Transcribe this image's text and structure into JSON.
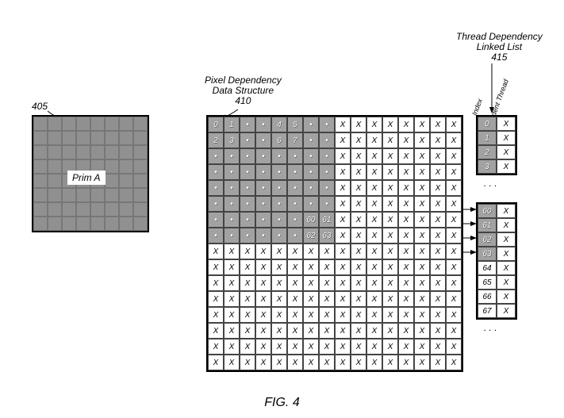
{
  "refs": {
    "prim": "405",
    "pds": "410",
    "tdll": "415"
  },
  "titles": {
    "pds_l1": "Pixel Dependency",
    "pds_l2": "Data Structure",
    "tdll_l1": "Thread Dependency",
    "tdll_l2": "Linked List",
    "col_index": "Index",
    "col_dep": "Dependent Thread"
  },
  "prim": {
    "label": "Prim A",
    "rows": 8,
    "cols": 8
  },
  "pds": {
    "rows": 16,
    "cols": 16,
    "numbered_cells": {
      "0,0": "0",
      "0,1": "1",
      "0,4": "4",
      "0,5": "5",
      "1,0": "2",
      "1,1": "3",
      "1,4": "6",
      "1,5": "7",
      "6,6": "60",
      "6,7": "61",
      "7,6": "62",
      "7,7": "63"
    }
  },
  "tdll": {
    "top": {
      "rows": [
        {
          "idx": "0",
          "dep": "X",
          "gray": true
        },
        {
          "idx": "1",
          "dep": "X",
          "gray": true
        },
        {
          "idx": "2",
          "dep": "X",
          "gray": true
        },
        {
          "idx": "3",
          "dep": "X",
          "gray": true
        }
      ]
    },
    "bottom": {
      "rows": [
        {
          "idx": "60",
          "dep": "X",
          "gray": true
        },
        {
          "idx": "61",
          "dep": "X",
          "gray": true
        },
        {
          "idx": "62",
          "dep": "X",
          "gray": true
        },
        {
          "idx": "63",
          "dep": "X",
          "gray": true
        },
        {
          "idx": "64",
          "dep": "X",
          "gray": false
        },
        {
          "idx": "65",
          "dep": "X",
          "gray": false
        },
        {
          "idx": "66",
          "dep": "X",
          "gray": false
        },
        {
          "idx": "67",
          "dep": "X",
          "gray": false
        }
      ]
    },
    "ellipsis": ". . ."
  },
  "figure": "FIG. 4",
  "chart_data": {
    "type": "table",
    "description": "Patent figure showing three structures: an 8x8 primitive grid (Prim A, ref 405), a 16x16 Pixel Dependency Data Structure (ref 410) where upper-left 8x8 quadrant is shaded/covered and remainder holds X markers, and a Thread Dependency Linked List (ref 415) with two columns Index and Dependent Thread. Arrows connect cells 60-63 in the pixel structure to rows 60-63 in the linked list.",
    "pixel_dependency_structure": {
      "dimensions": "16x16",
      "shaded_region": "rows 0-7, cols 0-7",
      "shaded_cell_labels": {
        "0,0": 0,
        "0,1": 1,
        "0,4": 4,
        "0,5": 5,
        "1,0": 2,
        "1,1": 3,
        "1,4": 6,
        "1,5": 7,
        "6,6": 60,
        "6,7": 61,
        "7,6": 62,
        "7,7": 63
      },
      "unshaded_cell_value": "X"
    },
    "thread_dependency_linked_list": {
      "columns": [
        "Index",
        "Dependent Thread"
      ],
      "top_rows": [
        [
          0,
          "X"
        ],
        [
          1,
          "X"
        ],
        [
          2,
          "X"
        ],
        [
          3,
          "X"
        ]
      ],
      "bottom_rows": [
        [
          60,
          "X"
        ],
        [
          61,
          "X"
        ],
        [
          62,
          "X"
        ],
        [
          63,
          "X"
        ],
        [
          64,
          "X"
        ],
        [
          65,
          "X"
        ],
        [
          66,
          "X"
        ],
        [
          67,
          "X"
        ]
      ]
    }
  }
}
